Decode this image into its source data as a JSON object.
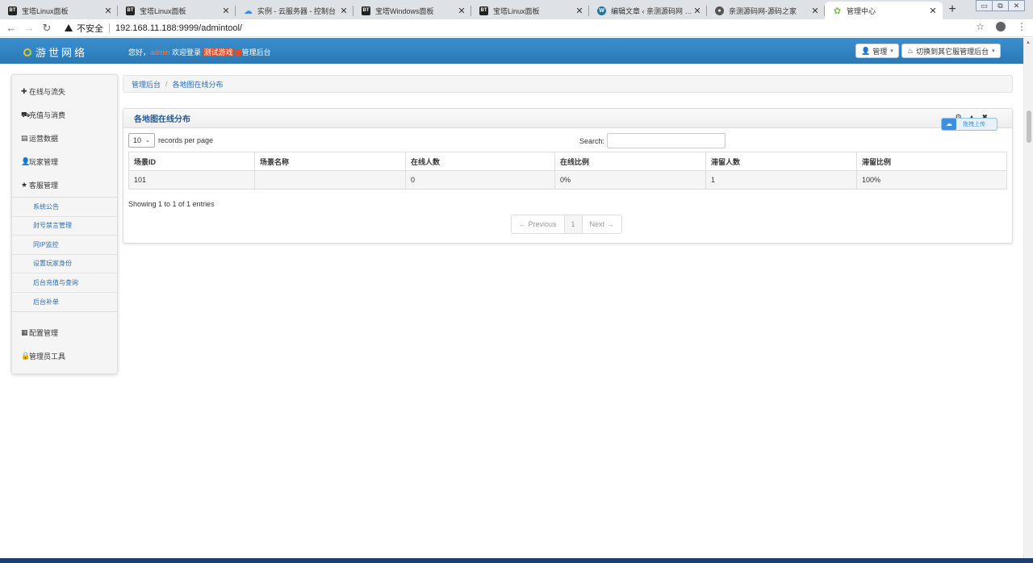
{
  "browser": {
    "tabs": [
      {
        "icon": "bt-icon",
        "title": "宝塔Linux面板"
      },
      {
        "icon": "bt-icon",
        "title": "宝塔Linux面板"
      },
      {
        "icon": "cloud-icon",
        "title": "实例 - 云服务器 - 控制台"
      },
      {
        "icon": "bt-icon",
        "title": "宝塔Windows面板"
      },
      {
        "icon": "bt-icon",
        "title": "宝塔Linux面板"
      },
      {
        "icon": "wordpress-icon",
        "title": "编辑文章 ‹ 亲测源码网 — W"
      },
      {
        "icon": "globe-icon",
        "title": "亲测源码网-源码之家"
      },
      {
        "icon": "leaf-icon",
        "title": "管理中心"
      }
    ],
    "security_label": "不安全",
    "url": "192.168.11.188:9999/admintool/"
  },
  "header": {
    "logo_text": "游世网络",
    "welcome_prefix": "您好，",
    "username": "admin",
    "welcome_mid": " 欢迎登录 ",
    "server_highlight": "测试游戏",
    "welcome_suffix": "管理后台",
    "admin_button": "管理",
    "switch_button": "切换到其它服管理后台"
  },
  "sidebar": {
    "items": [
      {
        "icon": "✚",
        "label": "在线与流失"
      },
      {
        "icon": "⛟",
        "label": "充值与消费"
      },
      {
        "icon": "▤",
        "label": "运营数据"
      },
      {
        "icon": "👤",
        "label": "玩家管理"
      },
      {
        "icon": "★",
        "label": "客服管理"
      }
    ],
    "subitems": [
      "系统公告",
      "封号禁言管理",
      "同IP监控",
      "设置玩家身份",
      "后台充值与查询",
      "后台补单"
    ],
    "bottom_items": [
      {
        "icon": "▦",
        "label": "配置管理"
      },
      {
        "icon": "🔒",
        "label": "管理员工具"
      }
    ]
  },
  "breadcrumb": {
    "home": "管理后台",
    "current": "各地图在线分布"
  },
  "box": {
    "title": "各地图在线分布",
    "upload_label": "拖拽上传"
  },
  "table_controls": {
    "page_size": "10",
    "records_label": "records per page",
    "search_label": "Search:",
    "search_value": ""
  },
  "table": {
    "columns": [
      "场景ID",
      "场景名称",
      "在线人数",
      "在线比例",
      "滞留人数",
      "滞留比例"
    ],
    "rows": [
      [
        "101",
        "",
        "0",
        "0%",
        "1",
        "100%"
      ]
    ]
  },
  "footer": {
    "info": "Showing 1 to 1 of 1 entries",
    "prev": "← Previous",
    "page": "1",
    "next": "Next →"
  }
}
